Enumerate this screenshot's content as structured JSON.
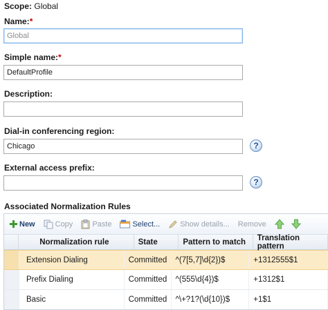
{
  "scope": {
    "label": "Scope:",
    "value": "Global"
  },
  "fields": {
    "name": {
      "label": "Name:",
      "required": "*",
      "value": "Global"
    },
    "simple_name": {
      "label": "Simple name:",
      "required": "*",
      "value": "DefaultProfile"
    },
    "description": {
      "label": "Description:",
      "value": ""
    },
    "dialin_region": {
      "label": "Dial-in conferencing region:",
      "value": "Chicago"
    },
    "external_prefix": {
      "label": "External access prefix:",
      "value": ""
    }
  },
  "help_icon_text": "?",
  "rules_section": {
    "title": "Associated Normalization Rules",
    "toolbar": {
      "new": "New",
      "copy": "Copy",
      "paste": "Paste",
      "select": "Select...",
      "show_details": "Show details...",
      "remove": "Remove"
    },
    "columns": [
      "Normalization rule",
      "State",
      "Pattern to match",
      "Translation pattern"
    ],
    "rows": [
      {
        "rule": "Extension Dialing",
        "state": "Committed",
        "pattern": "^(7[5,7]\\d{2})$",
        "translation": "+1312555$1"
      },
      {
        "rule": "Prefix Dialing",
        "state": "Committed",
        "pattern": "^(555\\d{4})$",
        "translation": "+1312$1"
      },
      {
        "rule": "Basic",
        "state": "Committed",
        "pattern": "^\\+?1?(\\d{10})$",
        "translation": "+1$1"
      }
    ]
  },
  "colors": {
    "selected_row": "#fcebc7",
    "required": "#c00000",
    "field_border": "#a9a9a9",
    "focus_border": "#7eb4ea",
    "toolbar_text": "#1f3f6e"
  }
}
